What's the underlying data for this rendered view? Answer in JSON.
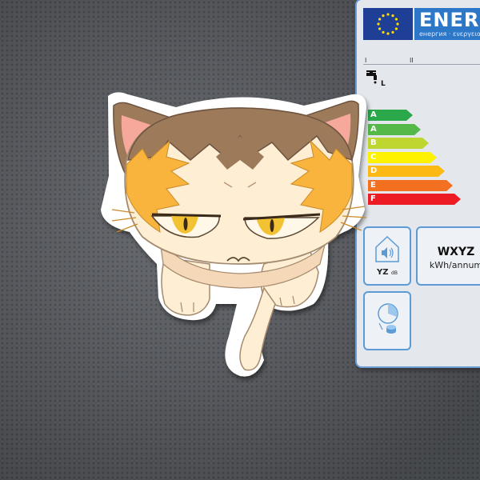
{
  "energy_label": {
    "title": "ENERG",
    "subtitle": "енергия · ενεργεια",
    "roman_1": "I",
    "roman_2": "II",
    "tap_letter": "L",
    "classes": [
      "A",
      "A",
      "B",
      "C",
      "D",
      "E",
      "F"
    ],
    "class_colors": [
      "#2aa84a",
      "#54b948",
      "#bfd630",
      "#fff200",
      "#fdb913",
      "#f37021",
      "#ed1c24"
    ],
    "noise_label": "YZ",
    "noise_unit": "dB",
    "consumption_value": "WXYZ",
    "consumption_unit": "kWh/annum"
  },
  "sticker": {
    "subject": "grumpy-calico-cat-sticker",
    "fur_colors": {
      "brown": "#9c7a5a",
      "orange": "#f8b43c",
      "cream": "#fdeed4"
    },
    "eye_color": "#f2c233"
  },
  "icons": [
    "eu-flag-icon",
    "water-tap-icon",
    "house-speaker-icon",
    "pie-drop-icon"
  ]
}
